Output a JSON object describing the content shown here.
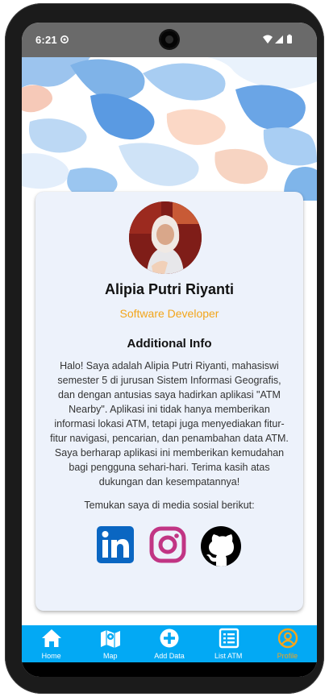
{
  "status_bar": {
    "time": "6:21"
  },
  "profile": {
    "name": "Alipia Putri Riyanti",
    "role": "Software Developer",
    "section_title": "Additional Info",
    "bio": "Halo! Saya adalah Alipia Putri Riyanti, mahasiswi semester 5 di jurusan Sistem Informasi Geografis, dan dengan antusias saya hadirkan aplikasi \"ATM Nearby\". Aplikasi ini tidak hanya memberikan informasi lokasi ATM, tetapi juga menyediakan fitur-fitur navigasi, pencarian, dan penambahan data ATM. Saya berharap aplikasi ini memberikan kemudahan bagi pengguna sehari-hari. Terima kasih atas dukungan dan kesempatannya!",
    "social_prompt": "Temukan saya di media sosial berikut:",
    "social_icons": [
      "linkedin-icon",
      "instagram-icon",
      "github-icon"
    ]
  },
  "bottom_nav": {
    "items": [
      {
        "label": "Home",
        "icon": "home-icon"
      },
      {
        "label": "Map",
        "icon": "map-icon"
      },
      {
        "label": "Add Data",
        "icon": "add-circle-icon"
      },
      {
        "label": "List ATM",
        "icon": "list-icon"
      },
      {
        "label": "Profile",
        "icon": "profile-icon"
      }
    ],
    "active": "Profile"
  },
  "colors": {
    "accent": "#f2a51a",
    "nav_background": "#03a9f4",
    "card_background": "#edf2fb",
    "linkedin": "#0a66c2",
    "instagram": "#c13584"
  }
}
